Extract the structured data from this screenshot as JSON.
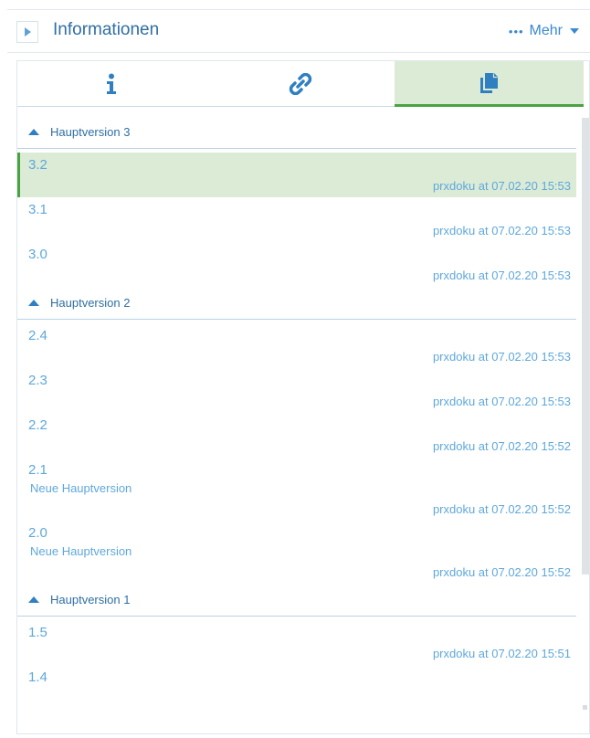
{
  "header": {
    "title": "Informationen",
    "more_label": "Mehr",
    "more_dots": "•••"
  },
  "tabs": [
    {
      "icon": "info-icon",
      "active": false
    },
    {
      "icon": "link-icon",
      "active": false
    },
    {
      "icon": "copy-documents-icon",
      "active": true
    }
  ],
  "groups": [
    {
      "title": "Hauptversion 3",
      "versions": [
        {
          "version": "3.2",
          "meta": "prxdoku at 07.02.20 15:53",
          "selected": true
        },
        {
          "version": "3.1",
          "meta": "prxdoku at 07.02.20 15:53"
        },
        {
          "version": "3.0",
          "meta": "prxdoku at 07.02.20 15:53"
        }
      ]
    },
    {
      "title": "Hauptversion 2",
      "versions": [
        {
          "version": "2.4",
          "meta": "prxdoku at 07.02.20 15:53"
        },
        {
          "version": "2.3",
          "meta": "prxdoku at 07.02.20 15:53"
        },
        {
          "version": "2.2",
          "meta": "prxdoku at 07.02.20 15:52"
        },
        {
          "version": "2.1",
          "comment": "Neue Hauptversion",
          "meta": "prxdoku at 07.02.20 15:52"
        },
        {
          "version": "2.0",
          "comment": "Neue Hauptversion",
          "meta": "prxdoku at 07.02.20 15:52"
        }
      ]
    },
    {
      "title": "Hauptversion 1",
      "versions": [
        {
          "version": "1.5",
          "meta": "prxdoku at 07.02.20 15:51"
        },
        {
          "version": "1.4",
          "meta": ""
        }
      ]
    }
  ],
  "colors": {
    "accent_blue": "#2f7fc1",
    "text_light_blue": "#5ea8dc",
    "selected_bg": "#dcebd6",
    "selected_green": "#4aa342"
  }
}
